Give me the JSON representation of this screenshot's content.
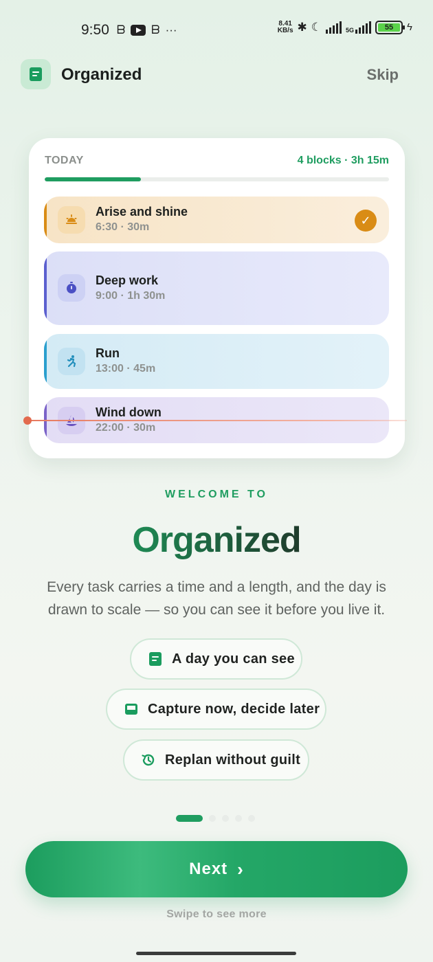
{
  "status_bar": {
    "time": "9:50",
    "network_speed_value": "8.41",
    "network_speed_unit": "KB/s",
    "network_type": "5G",
    "battery_level": "55",
    "left_icons": [
      "b-icon",
      "youtube-icon",
      "b-icon",
      "more-dots-icon"
    ],
    "right_icons": [
      "bluetooth-icon",
      "moon-icon",
      "signal-icon",
      "signal-icon",
      "battery-icon",
      "charging-icon"
    ]
  },
  "header": {
    "app_name": "Organized",
    "skip_label": "Skip"
  },
  "today_card": {
    "label": "TODAY",
    "summary": "4 blocks · 3h 15m",
    "progress_fraction": 0.28,
    "blocks": [
      {
        "title": "Arise and shine",
        "meta": "6:30 · 30m",
        "icon": "sunrise-icon",
        "color": "#d98c16",
        "done": true
      },
      {
        "title": "Deep work",
        "meta": "9:00 · 1h 30m",
        "icon": "timer-icon",
        "color": "#5b5fcf",
        "done": false
      },
      {
        "title": "Run",
        "meta": "13:00 · 45m",
        "icon": "run-icon",
        "color": "#2a9fce",
        "done": false
      },
      {
        "title": "Wind down",
        "meta": "22:00 · 30m",
        "icon": "moon-sail-icon",
        "color": "#7a62c8",
        "done": false
      }
    ],
    "check_glyph": "✓"
  },
  "welcome": {
    "eyebrow": "WELCOME TO",
    "title": "Organized",
    "description": "Every task carries a time and a length, and the day is drawn to scale — so you can see it before you live it."
  },
  "features": [
    {
      "label": "A day you can see",
      "icon": "doc-icon"
    },
    {
      "label": "Capture now, decide later",
      "icon": "inbox-tray-icon"
    },
    {
      "label": "Replan without guilt",
      "icon": "history-icon"
    }
  ],
  "pager": {
    "count": 5,
    "active_index": 0
  },
  "next_button": {
    "label": "Next"
  },
  "swipe_hint": "Swipe to see more",
  "colors": {
    "accent": "#1f9d60",
    "now_line": "#e26a4e"
  }
}
